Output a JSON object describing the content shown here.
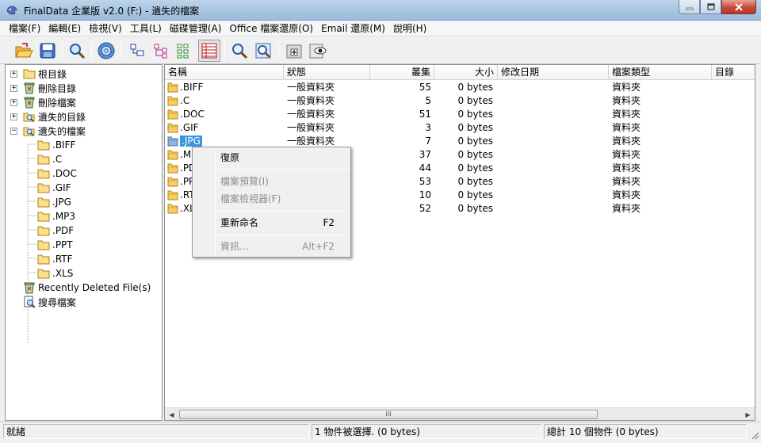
{
  "window": {
    "title": "FinalData 企業版 v2.0 (F:) - 遺失的檔案"
  },
  "menu": [
    "檔案(F)",
    "編輯(E)",
    "檢視(V)",
    "工具(L)",
    "磁碟管理(A)",
    "Office 檔案還原(O)",
    "Email 還原(M)",
    "說明(H)"
  ],
  "toolbar": {
    "icons": [
      "open-folder-icon",
      "save-icon",
      "search-icon",
      "disk-scan-icon",
      "large-icons-view-icon",
      "small-icons-view-icon",
      "list-view-icon",
      "details-view-icon",
      "find-file-icon",
      "find-advanced-icon",
      "new-folder-icon",
      "preview-icon"
    ]
  },
  "tree": {
    "root": "根目錄",
    "deleted_dirs": "刪除目錄",
    "deleted_files": "刪除檔案",
    "lost_dirs": "遺失的目錄",
    "lost_files": "遺失的檔案",
    "children": [
      ".BIFF",
      ".C",
      ".DOC",
      ".GIF",
      ".JPG",
      ".MP3",
      ".PDF",
      ".PPT",
      ".RTF",
      ".XLS"
    ],
    "recent": "Recently Deleted File(s)",
    "search": "搜尋檔案"
  },
  "list": {
    "headers": {
      "name": "名稱",
      "state": "狀態",
      "clusters": "叢集",
      "size": "大小",
      "modified": "修改日期",
      "type": "檔案類型",
      "dir": "目錄"
    },
    "rows": [
      {
        "name": ".BIFF",
        "state": "一般資料夾",
        "clusters": "55",
        "size": "0 bytes",
        "type": "資料夾"
      },
      {
        "name": ".C",
        "state": "一般資料夾",
        "clusters": "5",
        "size": "0 bytes",
        "type": "資料夾"
      },
      {
        "name": ".DOC",
        "state": "一般資料夾",
        "clusters": "51",
        "size": "0 bytes",
        "type": "資料夾"
      },
      {
        "name": ".GIF",
        "state": "一般資料夾",
        "clusters": "3",
        "size": "0 bytes",
        "type": "資料夾"
      },
      {
        "name": ".JPG",
        "state": "一般資料夾",
        "clusters": "7",
        "size": "0 bytes",
        "type": "資料夾"
      },
      {
        "name": ".M",
        "state": "",
        "clusters": "37",
        "size": "0 bytes",
        "type": "資料夾"
      },
      {
        "name": ".PD",
        "state": "",
        "clusters": "44",
        "size": "0 bytes",
        "type": "資料夾"
      },
      {
        "name": ".PP",
        "state": "",
        "clusters": "53",
        "size": "0 bytes",
        "type": "資料夾"
      },
      {
        "name": ".RT",
        "state": "",
        "clusters": "10",
        "size": "0 bytes",
        "type": "資料夾"
      },
      {
        "name": ".XL",
        "state": "",
        "clusters": "52",
        "size": "0 bytes",
        "type": "資料夾"
      }
    ],
    "scroll_thumb": "III"
  },
  "context_menu": {
    "restore": "復原",
    "preview": "檔案預覽(I)",
    "viewer": "檔案檢視器(F)",
    "rename": "重新命名",
    "rename_key": "F2",
    "info": "資訊...",
    "info_key": "Alt+F2"
  },
  "status": {
    "ready": "就緒",
    "selected": "1 物件被選擇. (0 bytes)",
    "total": "總計 10 個物件 (0 bytes)"
  }
}
